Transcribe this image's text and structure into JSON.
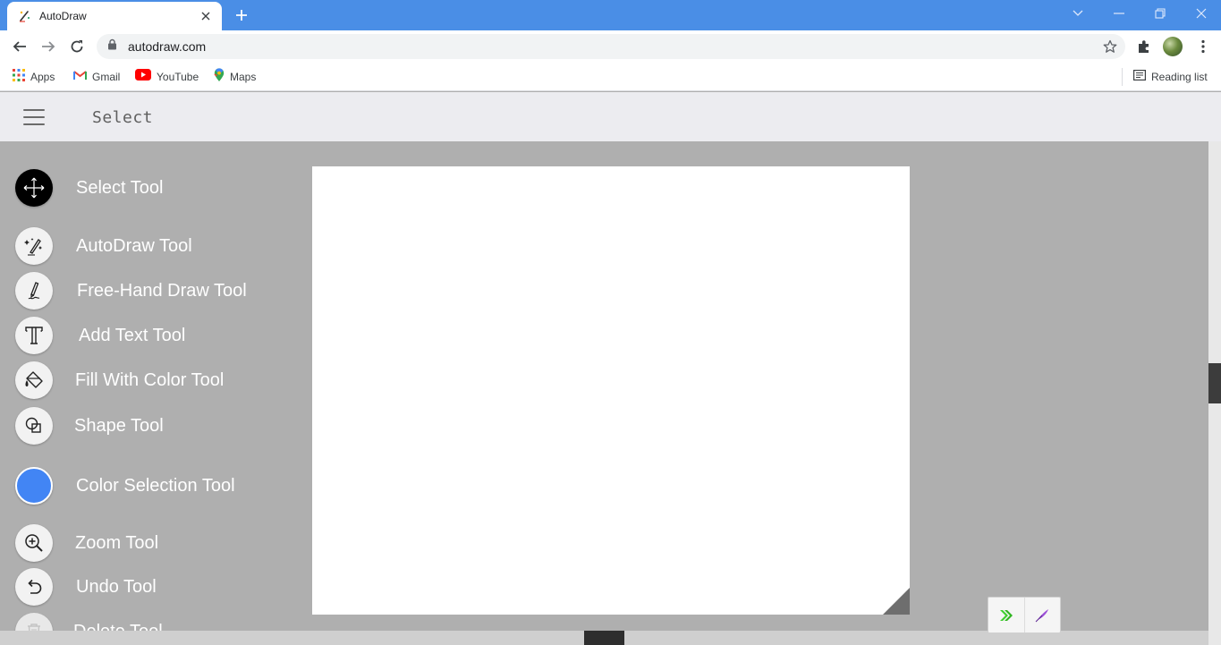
{
  "browser": {
    "tab_title": "AutoDraw",
    "url": "autodraw.com"
  },
  "bookmarks": [
    {
      "label": "Apps",
      "icon": "apps-grid-icon"
    },
    {
      "label": "Gmail",
      "icon": "gmail-icon"
    },
    {
      "label": "YouTube",
      "icon": "youtube-icon"
    },
    {
      "label": "Maps",
      "icon": "maps-icon"
    }
  ],
  "reading_list": {
    "label": "Reading list",
    "icon": "reading-list-icon"
  },
  "header": {
    "mode_title": "Select",
    "menu_icon": "hamburger-menu-icon"
  },
  "tools": [
    {
      "label": "Select Tool",
      "icon": "move-arrows-icon",
      "active": true
    },
    {
      "label": "AutoDraw Tool",
      "icon": "autodraw-sparkle-pen-icon"
    },
    {
      "label": "Free-Hand Draw Tool",
      "icon": "pencil-icon"
    },
    {
      "label": "Add Text Tool",
      "icon": "text-t-icon"
    },
    {
      "label": "Fill With Color Tool",
      "icon": "paint-bucket-icon"
    },
    {
      "label": "Shape Tool",
      "icon": "shapes-icon"
    },
    {
      "label": "Color Selection Tool",
      "icon": "color-swatch",
      "color": "#4285f4"
    },
    {
      "label": "Zoom Tool",
      "icon": "zoom-in-icon"
    },
    {
      "label": "Undo Tool",
      "icon": "undo-icon"
    },
    {
      "label": "Delete Tool",
      "icon": "trash-icon"
    }
  ],
  "colors": {
    "browser_chrome": "#4a8ee6",
    "workspace_bg": "#afafaf",
    "header_bg": "#ececf0",
    "selected_color": "#4285f4"
  }
}
